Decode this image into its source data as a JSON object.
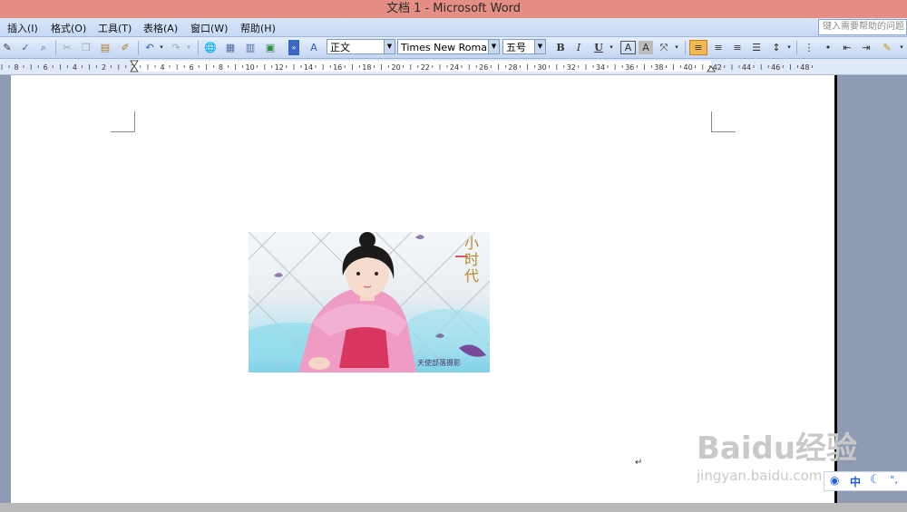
{
  "window": {
    "title": "文档 1 - Microsoft Word"
  },
  "menu": {
    "items": [
      "插入(I)",
      "格式(O)",
      "工具(T)",
      "表格(A)",
      "窗口(W)",
      "帮助(H)"
    ],
    "help_placeholder": "键入需要帮助的问题"
  },
  "toolbar": {
    "style": "正文",
    "font": "Times New Roman",
    "size": "五号",
    "bold": "B",
    "italic": "I",
    "underline": "U",
    "font_color": "A",
    "highlight": "A"
  },
  "ruler": {
    "labels": [
      "8",
      "6",
      "4",
      "2",
      "2",
      "4",
      "6",
      "8",
      "10",
      "12",
      "14",
      "16",
      "18",
      "20",
      "22",
      "24",
      "26",
      "28",
      "30",
      "32",
      "34",
      "36",
      "38",
      "40",
      "42",
      "44",
      "46",
      "48"
    ]
  },
  "document": {
    "image_caption_title": "小时代",
    "image_logo": "天使部落摄影",
    "return_mark": "↵"
  },
  "ime": {
    "mode": "中"
  },
  "watermark": {
    "brand": "Baidu经验",
    "url": "jingyan.baidu.com"
  }
}
